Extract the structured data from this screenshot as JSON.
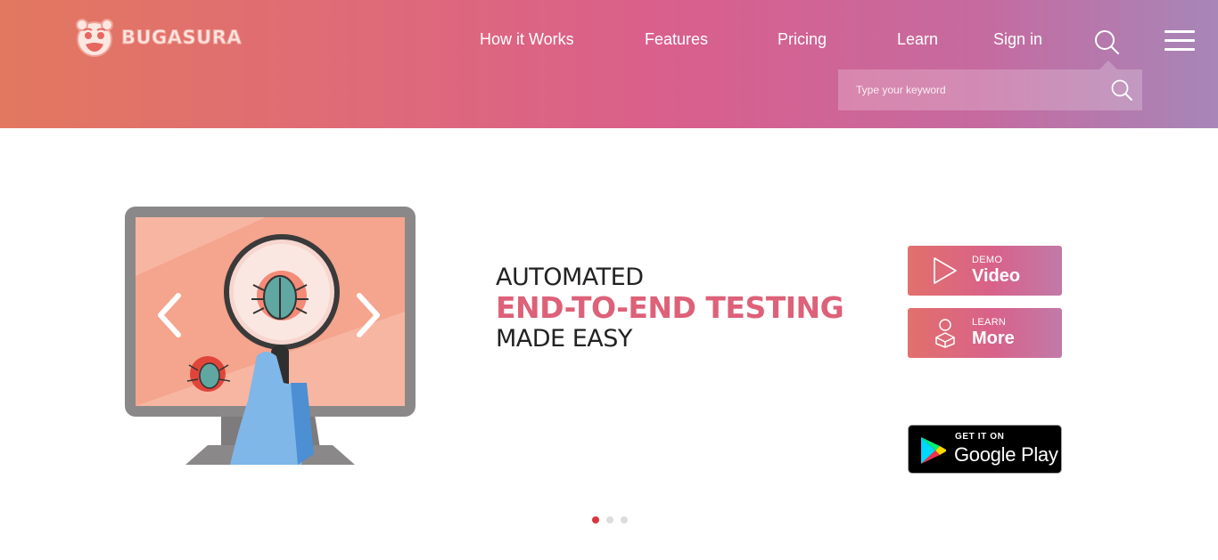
{
  "brand": {
    "name": "BUGASURA",
    "logo_icon": "bug-face-logo"
  },
  "nav": {
    "items": [
      {
        "label": "How it Works"
      },
      {
        "label": "Features"
      },
      {
        "label": "Pricing"
      },
      {
        "label": "Learn"
      },
      {
        "label": "Sign in"
      }
    ],
    "search_icon": "search-icon",
    "menu_icon": "hamburger-menu-icon"
  },
  "search": {
    "placeholder": "Type your keyword",
    "value": ""
  },
  "hero": {
    "line1": "AUTOMATED",
    "line2": "END-TO-END TESTING",
    "line3": "MADE EASY",
    "highlight_color": "#dd6178"
  },
  "cta": {
    "demo": {
      "small": "DEMO",
      "big": "Video",
      "icon": "play-icon"
    },
    "learn": {
      "small": "LEARN",
      "big": "More",
      "icon": "learner-icon"
    }
  },
  "store_badge": {
    "small": "GET IT ON",
    "big": "Google Play"
  },
  "carousel": {
    "slide_count": 3,
    "active_index": 0
  },
  "colors": {
    "gradient_start": "#e2785f",
    "gradient_end": "#a786b8",
    "accent": "#dd6178",
    "active_dot": "#d8363e"
  }
}
